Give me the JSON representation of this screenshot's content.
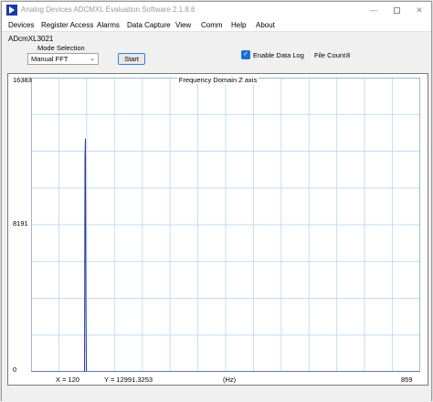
{
  "window": {
    "title": "Analog Devices ADCMXL Evaluation Software  2.1.8.6",
    "minimize_glyph": "—",
    "close_glyph": "✕"
  },
  "menu": {
    "items": [
      "Devices",
      "Register Access",
      "Alarms",
      "Data Capture",
      "View",
      "Comm",
      "Help",
      "About"
    ]
  },
  "device": {
    "name": "ADcmXL3021"
  },
  "controls": {
    "mode_label": "Mode Selection",
    "mode_value": "Manual FFT",
    "start_label": "Start",
    "enable_log_label": "Enable Data Log",
    "enable_log_checked": true,
    "file_count_label": "File Count",
    "file_count_value": "8"
  },
  "chart": {
    "title": "Frequency Domain Z axis",
    "y_ticks": [
      "16383",
      "8191",
      "0"
    ],
    "cursor_x": "X = 120",
    "cursor_y": "Y = 12991.3253",
    "x_unit": "(Hz)",
    "x_max_label": "859",
    "colors": {
      "grid": "#c5dcf0",
      "trace": "#2b3a9c"
    }
  },
  "chart_data": {
    "type": "line",
    "title": "Frequency Domain Z axis",
    "xlabel": "(Hz)",
    "ylabel": "",
    "xlim": [
      0,
      859
    ],
    "ylim": [
      0,
      16383
    ],
    "y_ticks": [
      0,
      8191,
      16383
    ],
    "grid": true,
    "series": [
      {
        "x": [
          0,
          118,
          119,
          120,
          121,
          122,
          859
        ],
        "y": [
          0,
          0,
          12000,
          12991.3253,
          4000,
          0,
          0
        ]
      }
    ]
  }
}
